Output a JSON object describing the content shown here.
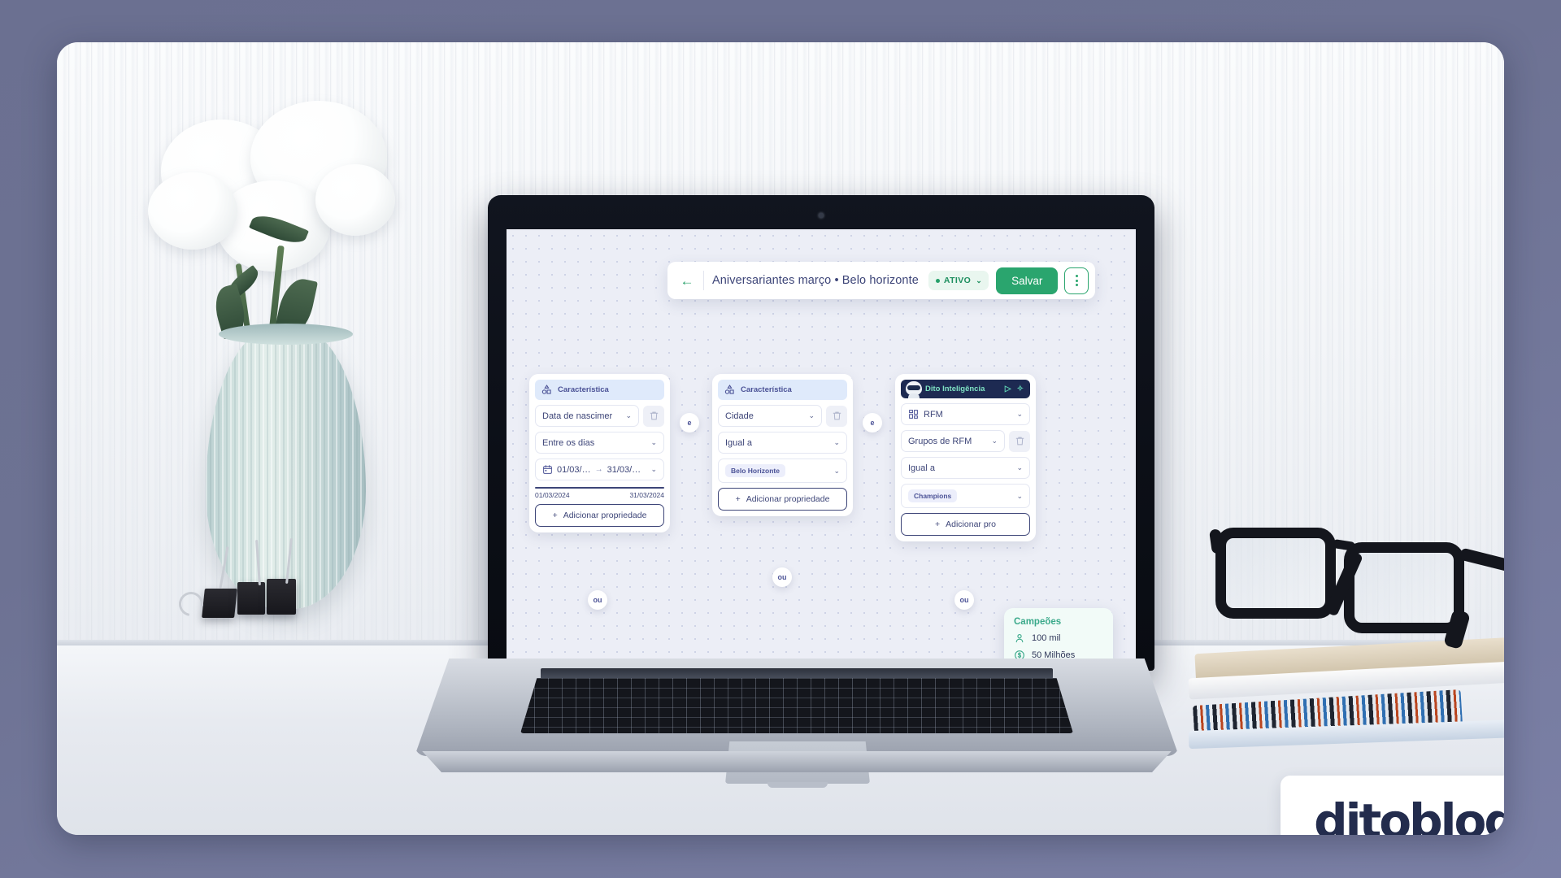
{
  "header": {
    "back_icon": "arrow-left-icon",
    "title": "Aniversariantes março • Belo horizonte",
    "status_label": "ATIVO",
    "status_caret": "⌄",
    "save_label": "Salvar",
    "kebab_icon": "more-vertical-icon",
    "accent_green": "#2aa56e",
    "title_color": "#3d4578"
  },
  "cards": [
    {
      "head_label": "Característica",
      "head_icon": "shapes-icon",
      "fields": [
        {
          "label": "Data de nascimer",
          "caret": "⌄",
          "has_delete": true
        },
        {
          "label": "Entre os dias",
          "caret": "⌄",
          "has_delete": false
        }
      ],
      "date_range": {
        "icon": "calendar-icon",
        "start": "01/03/…",
        "arrow": "→",
        "end": "31/03/…",
        "caret": "⌄",
        "start_full": "01/03/2024",
        "end_full": "31/03/2024"
      },
      "add_label": "Adicionar propriedade"
    },
    {
      "head_label": "Característica",
      "head_icon": "shapes-icon",
      "fields": [
        {
          "label": "Cidade",
          "caret": "⌄",
          "has_delete": true
        },
        {
          "label": "Igual a",
          "caret": "⌄",
          "has_delete": false
        }
      ],
      "tag": "Belo Horizonte",
      "add_label": "Adicionar propriedade"
    },
    {
      "head_label": "Dito Inteligência",
      "head_icon": "robot-icon",
      "ai_icons": [
        "play-icon",
        "sparkle-icon"
      ],
      "fields": [
        {
          "label": "RFM",
          "icon": "grid-icon",
          "caret": "⌄",
          "has_delete": false
        },
        {
          "label": "Grupos de RFM",
          "caret": "⌄",
          "has_delete": true
        },
        {
          "label": "Igual a",
          "caret": "⌄",
          "has_delete": false
        }
      ],
      "tag": "Champions",
      "add_label": "Adicionar pro"
    }
  ],
  "connectors": {
    "and_1": "e",
    "and_2": "e",
    "or_1": "ou",
    "or_2": "ou",
    "or_3": "ou"
  },
  "tooltip": {
    "title": "Campeões",
    "people_icon": "user-icon",
    "people_value": "100 mil",
    "money_icon": "dollar-circle-icon",
    "money_value": "50 Milhões",
    "accent": "#3aa98a"
  },
  "logo": {
    "text_a": "dit",
    "text_b": "o",
    "text_c": "blog",
    "full": "ditoblog",
    "accent": "#35c07e",
    "dark": "#232c4d"
  }
}
